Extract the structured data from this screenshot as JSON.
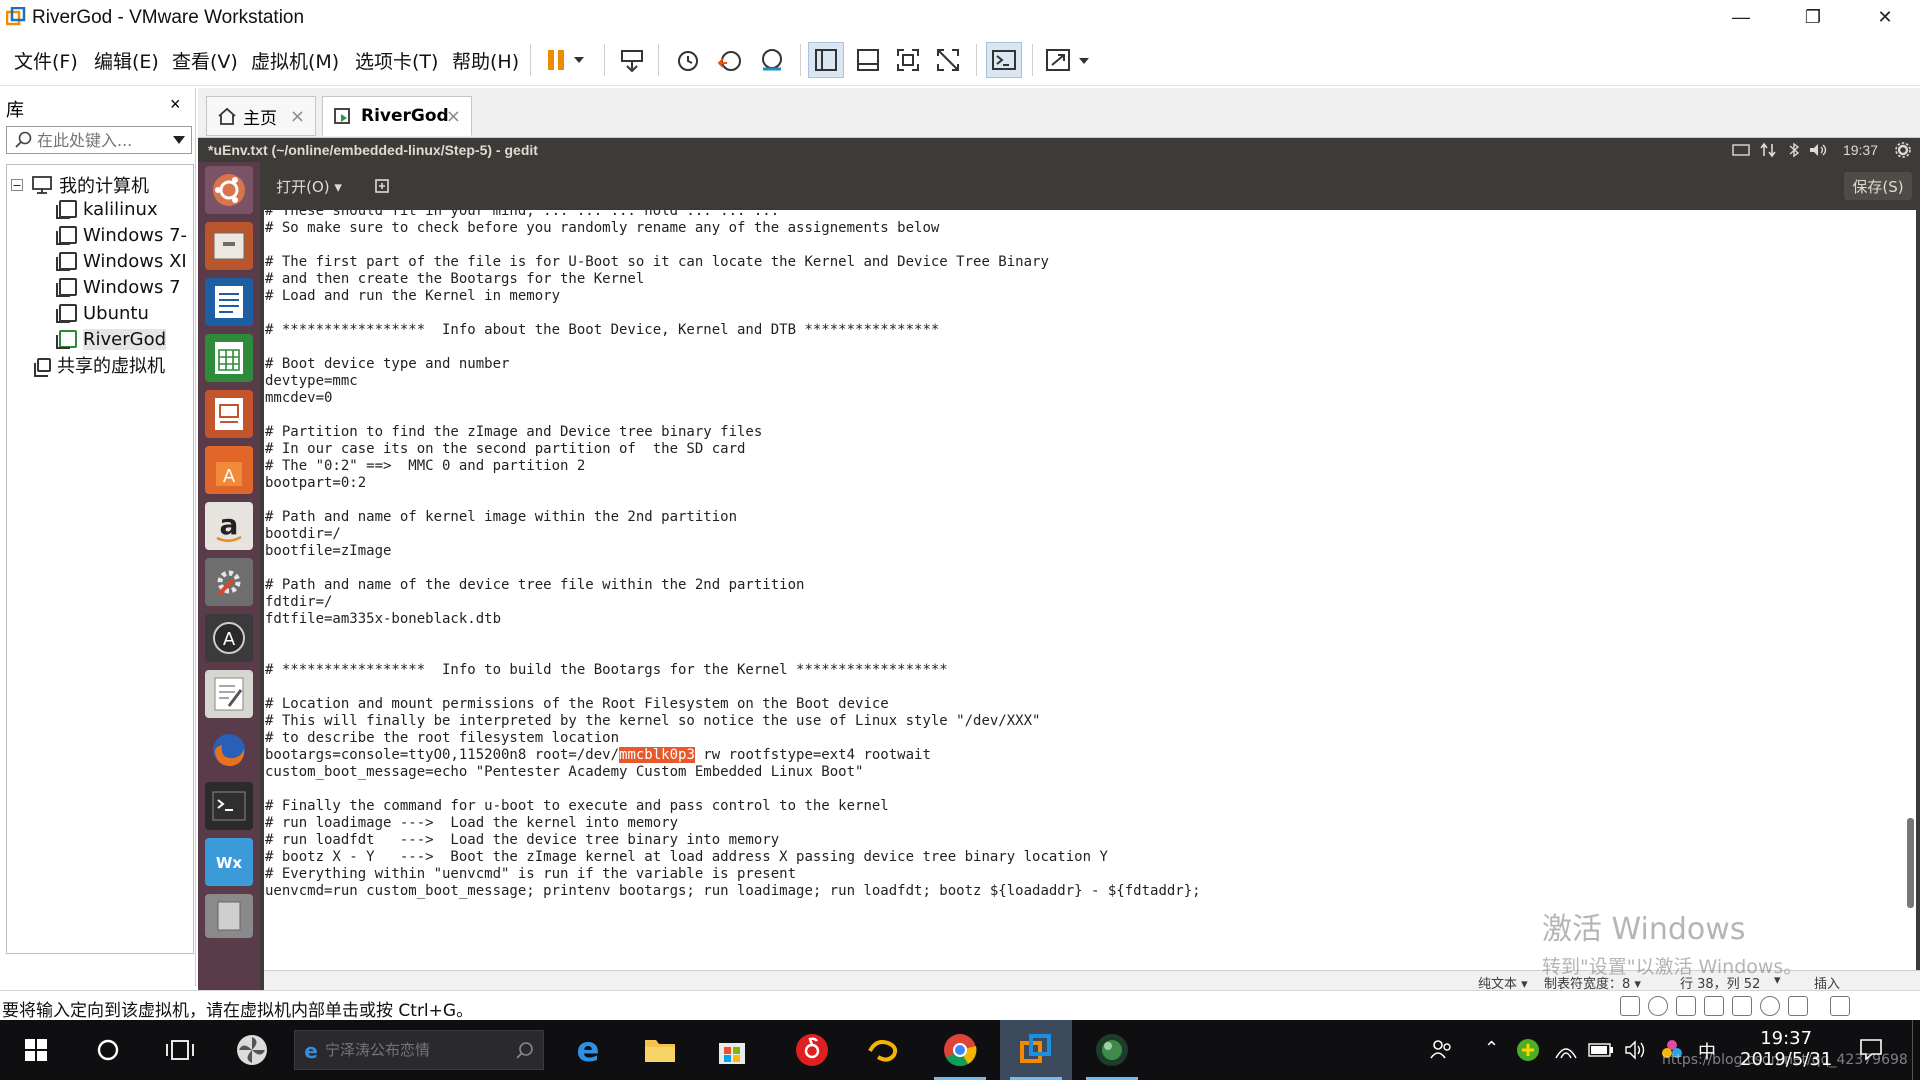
{
  "window": {
    "title": "RiverGod - VMware Workstation",
    "minimize": "—",
    "maximize": "❐",
    "close": "✕"
  },
  "menu": [
    "文件(F)",
    "编辑(E)",
    "查看(V)",
    "虚拟机(M)",
    "选项卡(T)",
    "帮助(H)"
  ],
  "library": {
    "title": "库",
    "close": "×",
    "search_placeholder": "在此处键入...",
    "tree": [
      {
        "label": "我的计算机",
        "level": 0,
        "type": "computer"
      },
      {
        "label": "kalilinux",
        "level": 1,
        "type": "vm"
      },
      {
        "label": "Windows 7-",
        "level": 1,
        "type": "vm"
      },
      {
        "label": "Windows XI",
        "level": 1,
        "type": "vm"
      },
      {
        "label": "Windows 7",
        "level": 1,
        "type": "vm"
      },
      {
        "label": "Ubuntu",
        "level": 1,
        "type": "vm"
      },
      {
        "label": "RiverGod",
        "level": 1,
        "type": "vm",
        "selected": true
      },
      {
        "label": "共享的虚拟机",
        "level": 0,
        "type": "shared"
      }
    ]
  },
  "tabs": [
    {
      "label": "主页",
      "close": "×",
      "active": false
    },
    {
      "label": "RiverGod",
      "close": "×",
      "active": true
    }
  ],
  "guest": {
    "panel_title": "*uEnv.txt (~/online/embedded-linux/Step-5) - gedit",
    "clock": "19:37",
    "open_button": "打开(O) ▾",
    "save_button": "保存(S)",
    "editor_lines_before": "# These should fit in your mind, ... ... ... hold ... ... ...\n# So make sure to check before you randomly rename any of the assignements below\n\n# The first part of the file is for U-Boot so it can locate the Kernel and Device Tree Binary\n# and then create the Bootargs for the Kernel\n# Load and run the Kernel in memory\n\n# *****************  Info about the Boot Device, Kernel and DTB ****************\n\n# Boot device type and number\ndevtype=mmc\nmmcdev=0\n\n# Partition to find the zImage and Device tree binary files\n# In our case its on the second partition of  the SD card\n# The \"0:2\" ==>  MMC 0 and partition 2\nbootpart=0:2\n\n# Path and name of kernel image within the 2nd partition\nbootdir=/\nbootfile=zImage\n\n# Path and name of the device tree file within the 2nd partition\nfdtdir=/\nfdtfile=am335x-boneblack.dtb\n\n\n# *****************  Info to build the Bootargs for the Kernel ******************\n\n# Location and mount permissions of the Root Filesystem on the Boot device\n# This will finally be interpreted by the kernel so notice the use of Linux style \"/dev/XXX\"\n# to describe the root filesystem location\nbootargs=console=ttyO0,115200n8 root=/dev/",
    "editor_highlight": "mmcblk0p3",
    "editor_lines_after": " rw rootfstype=ext4 rootwait\ncustom_boot_message=echo \"Pentester Academy Custom Embedded Linux Boot\"\n\n# Finally the command for u-boot to execute and pass control to the kernel\n# run loadimage --->  Load the kernel into memory\n# run loadfdt   --->  Load the device tree binary into memory\n# bootz X - Y   --->  Boot the zImage kernel at load address X passing device tree binary location Y\n# Everything within \"uenvcmd\" is run if the variable is present\nuenvcmd=run custom_boot_message; printenv bootargs; run loadimage; run loadfdt; bootz ${loadaddr} - ${fdtaddr};",
    "status": {
      "mode": "纯文本 ▾",
      "tab_width": "制表符宽度：8 ▾",
      "position": "行 38，列 52",
      "insert": "插入"
    }
  },
  "activation": {
    "line1": "激活 Windows",
    "line2": "转到\"设置\"以激活 Windows。"
  },
  "vm_status": {
    "message": "要将输入定向到该虚拟机，请在虚拟机内部单击或按 Ctrl+G。"
  },
  "taskbar": {
    "search_placeholder": "宁泽涛公布恋情",
    "time": "19:37",
    "date": "2019/5/31",
    "ime": "中",
    "url_watermark": "https://blog.csdn.net/qq_42379698"
  },
  "colors": {
    "ubuntu_panel": "#3c3b37",
    "launcher": "#5a3b4a",
    "highlight": "#e9582a",
    "taskbar": "#0f0f12"
  }
}
